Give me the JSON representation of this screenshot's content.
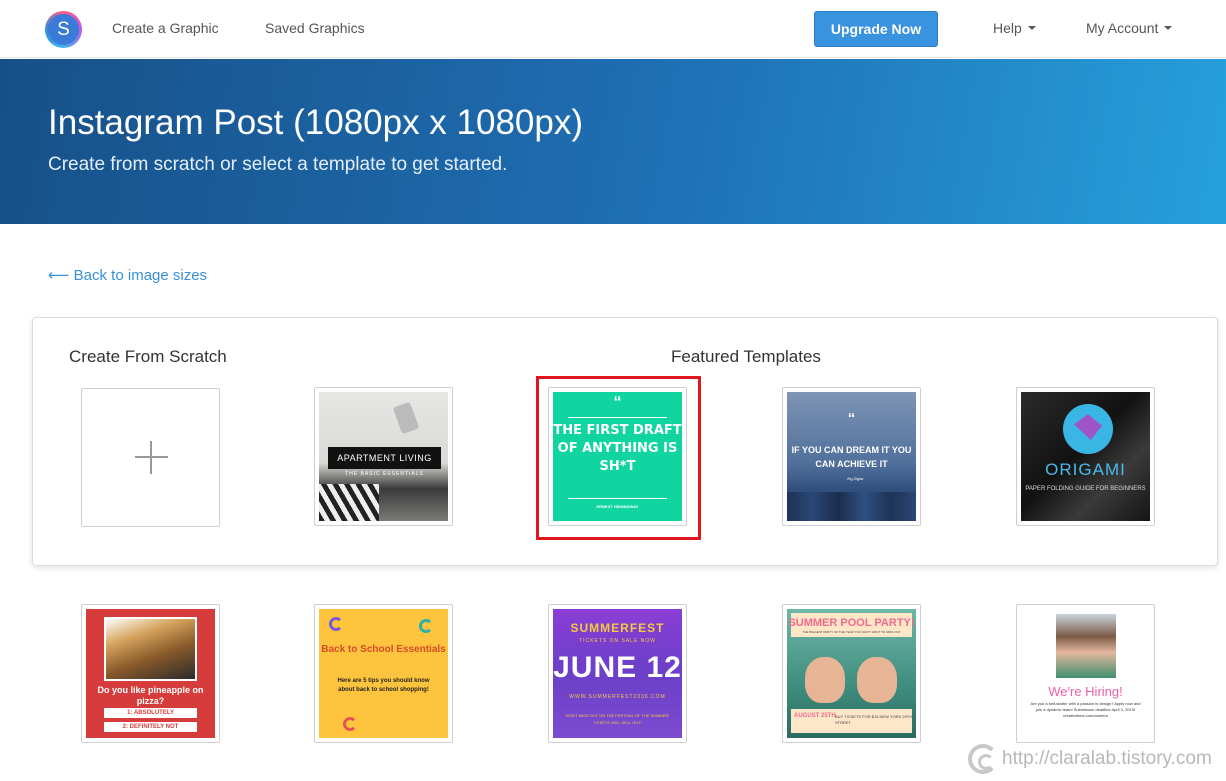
{
  "nav": {
    "logo_letter": "S",
    "create_graphic": "Create a Graphic",
    "saved_graphics": "Saved Graphics",
    "upgrade": "Upgrade Now",
    "help": "Help",
    "my_account": "My Account"
  },
  "hero": {
    "title": "Instagram Post (1080px x 1080px)",
    "subtitle": "Create from scratch or select a template to get started."
  },
  "back_link": "⟵ Back to image sizes",
  "panel": {
    "scratch_title": "Create From Scratch",
    "featured_title": "Featured Templates"
  },
  "templates": {
    "apartment": {
      "title": "APARTMENT LIVING",
      "sub": "THE BASIC ESSENTIALS"
    },
    "quote1": {
      "mark": "“",
      "text": "THE FIRST DRAFT OF ANYTHING IS SH*T",
      "author": "ERNEST HEMINGWAY"
    },
    "dream": {
      "mark": "“",
      "text": "IF YOU CAN DREAM IT YOU CAN ACHIEVE IT",
      "author": "Zig Ziglar"
    },
    "origami": {
      "name": "ORIGAMI",
      "sub": "PAPER FOLDING GUIDE FOR BEGINNERS"
    },
    "pizza": {
      "question": "Do you like pineapple on pizza?",
      "opt1": "1: ABSOLUTELY",
      "opt2": "2: DEFINITELY NOT"
    },
    "school": {
      "title": "Back to School Essentials",
      "text": "Here are 5 tips you should know about back to school shopping!"
    },
    "summerfest": {
      "title": "SUMMERFEST",
      "sale": "TICKETS ON SALE NOW",
      "date": "JUNE 12",
      "url": "WWW.SUMMERFEST2036.COM",
      "small": "DON'T MISS OUT ON THE FESTIVAL OF THE SUMMER! TICKETS WILL SELL OUT!"
    },
    "pool": {
      "title": "SUMMER POOL PARTY!",
      "sub": "THE BIGGEST PARTY OF THE YEAR YOU DON'T WANT TO MISS OUT",
      "date": "AUGUST 25TH",
      "info": "BUY TICKETS FOR $15 NEW YORK 29TH STREET"
    },
    "hiring": {
      "title": "We're Hiring!",
      "text": "Are you a self-starter with a passion in design? Apply now and join a dynamic team! Submission deadline April 3, 2019! creativetime.com/careers"
    }
  },
  "watermark": "http://claralab.tistory.com"
}
